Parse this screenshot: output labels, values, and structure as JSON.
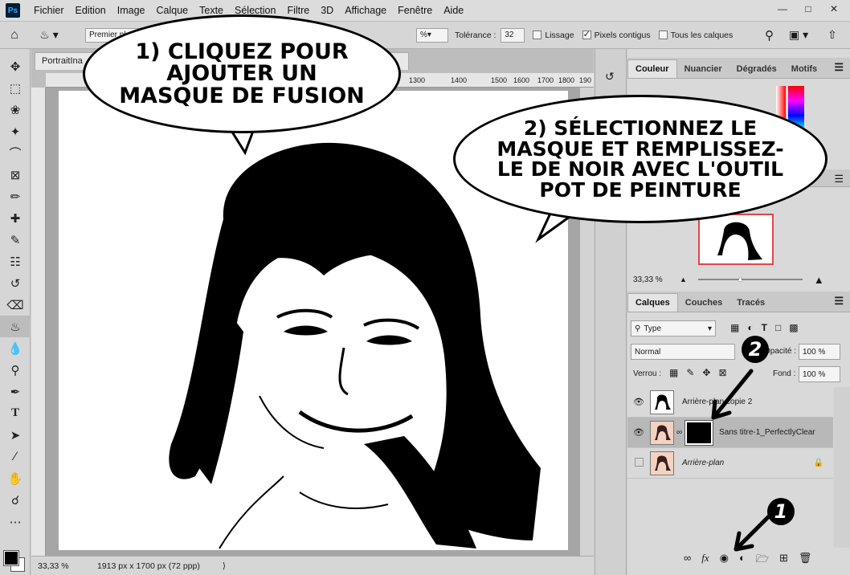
{
  "menu": [
    "Fichier",
    "Edition",
    "Image",
    "Calque",
    "Texte",
    "Sélection",
    "Filtre",
    "3D",
    "Affichage",
    "Fenêtre",
    "Aide"
  ],
  "options": {
    "mode_value": "Premier plan",
    "opacity_value": "%",
    "tolerance_label": "Tolérance :",
    "tolerance_value": "32",
    "lissage_label": "Lissage",
    "contigus_label": "Pixels contigus",
    "tous_calques_label": "Tous les calques"
  },
  "document": {
    "tab_title": "PortraitIna",
    "ruler_ticks": [
      "1300",
      "1400",
      "1500",
      "1600",
      "1700",
      "1800",
      "190"
    ],
    "zoom": "33,33 %",
    "size_info": "1913 px x 1700 px (72 ppp)"
  },
  "color_panel": {
    "tabs": [
      "Couleur",
      "Nuancier",
      "Dégradés",
      "Motifs"
    ]
  },
  "navigator": {
    "zoom": "33,33 %"
  },
  "layers_panel": {
    "tabs": [
      "Calques",
      "Couches",
      "Tracés"
    ],
    "filter_value": "Type",
    "blend_mode": "Normal",
    "opacity_label": "Opacité :",
    "opacity_value": "100 %",
    "lock_label": "Verrou :",
    "fill_label": "Fond :",
    "fill_value": "100 %",
    "layers": [
      {
        "name": "Arrière-plan copie 2",
        "visible": true,
        "selected": false
      },
      {
        "name": "Sans titre-1_PerfectlyClear",
        "visible": true,
        "selected": true
      },
      {
        "name": "Arrière-plan",
        "visible": false,
        "selected": false
      }
    ]
  },
  "annotations": {
    "bubble1": "1) Cliquez pour ajouter un masque de fusion",
    "bubble2": "2) Sélectionnez le masque et remplissez-le de noir avec l'outil pot de peinture",
    "badge1": "1",
    "badge2": "2"
  },
  "colors": {
    "fg": "#000000",
    "bg": "#ffffff",
    "accent": "#31a8ff"
  }
}
